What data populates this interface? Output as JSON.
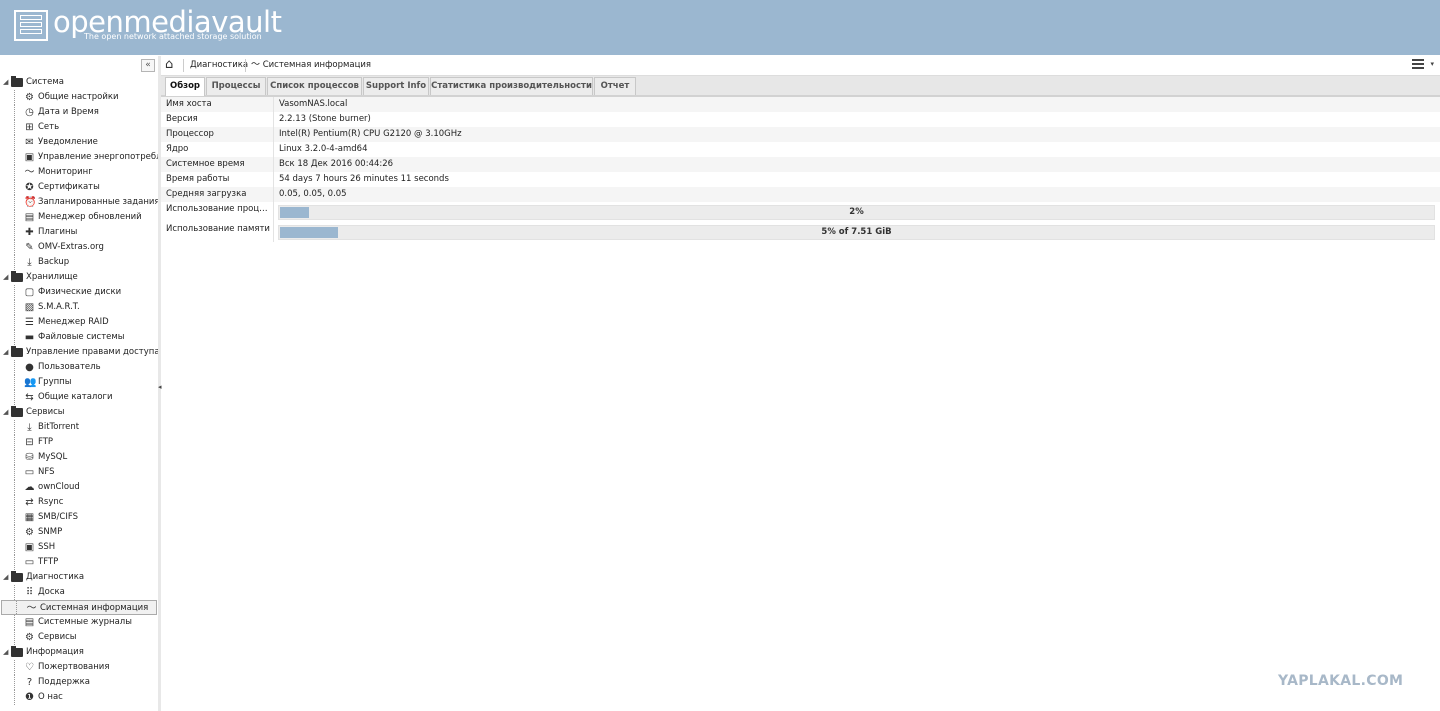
{
  "app": {
    "title": "openmediavault",
    "subtitle": "The open network attached storage solution"
  },
  "sidebar": {
    "collapse_label": "«",
    "sections": [
      {
        "label": "Система",
        "items": [
          {
            "label": "Общие настройки",
            "icon": "⚙"
          },
          {
            "label": "Дата и Время",
            "icon": "◷"
          },
          {
            "label": "Сеть",
            "icon": "⊞"
          },
          {
            "label": "Уведомление",
            "icon": "✉"
          },
          {
            "label": "Управление энергопотреблением",
            "icon": "▣"
          },
          {
            "label": "Мониторинг",
            "icon": "〜"
          },
          {
            "label": "Сертификаты",
            "icon": "✪"
          },
          {
            "label": "Запланированные задания",
            "icon": "⏰"
          },
          {
            "label": "Менеджер обновлений",
            "icon": "▤"
          },
          {
            "label": "Плагины",
            "icon": "✚"
          },
          {
            "label": "OMV-Extras.org",
            "icon": "✎"
          },
          {
            "label": "Backup",
            "icon": "⤓"
          }
        ]
      },
      {
        "label": "Хранилище",
        "items": [
          {
            "label": "Физические диски",
            "icon": "▢"
          },
          {
            "label": "S.M.A.R.T.",
            "icon": "▨"
          },
          {
            "label": "Менеджер RAID",
            "icon": "☰"
          },
          {
            "label": "Файловые системы",
            "icon": "▬"
          }
        ]
      },
      {
        "label": "Управление правами доступа",
        "items": [
          {
            "label": "Пользователь",
            "icon": "●"
          },
          {
            "label": "Группы",
            "icon": "👥"
          },
          {
            "label": "Общие каталоги",
            "icon": "⇆"
          }
        ]
      },
      {
        "label": "Сервисы",
        "items": [
          {
            "label": "BitTorrent",
            "icon": "⤓"
          },
          {
            "label": "FTP",
            "icon": "⊟"
          },
          {
            "label": "MySQL",
            "icon": "⛁"
          },
          {
            "label": "NFS",
            "icon": "▭"
          },
          {
            "label": "ownCloud",
            "icon": "☁"
          },
          {
            "label": "Rsync",
            "icon": "⇄"
          },
          {
            "label": "SMB/CIFS",
            "icon": "▦"
          },
          {
            "label": "SNMP",
            "icon": "⚙"
          },
          {
            "label": "SSH",
            "icon": "▣"
          },
          {
            "label": "TFTP",
            "icon": "▭"
          }
        ]
      },
      {
        "label": "Диагностика",
        "items": [
          {
            "label": "Доска",
            "icon": "⠿"
          },
          {
            "label": "Системная информация",
            "icon": "〜",
            "selected": true
          },
          {
            "label": "Системные журналы",
            "icon": "▤"
          },
          {
            "label": "Сервисы",
            "icon": "⚙"
          }
        ]
      },
      {
        "label": "Информация",
        "items": [
          {
            "label": "Пожертвования",
            "icon": "♡"
          },
          {
            "label": "Поддержка",
            "icon": "?"
          },
          {
            "label": "О нас",
            "icon": "❶"
          }
        ]
      }
    ]
  },
  "breadcrumb": {
    "home_icon": "home-icon",
    "items": [
      "Диагностика",
      "Системная информация"
    ]
  },
  "tabs": [
    "Обзор",
    "Процессы",
    "Список процессов",
    "Support Info",
    "Статистика производительности",
    "Отчет"
  ],
  "overview": {
    "rows": [
      {
        "key": "Имя хоста",
        "value": "VasomNAS.local"
      },
      {
        "key": "Версия",
        "value": "2.2.13 (Stone burner)"
      },
      {
        "key": "Процессор",
        "value": "Intel(R) Pentium(R) CPU G2120 @ 3.10GHz"
      },
      {
        "key": "Ядро",
        "value": "Linux 3.2.0-4-amd64"
      },
      {
        "key": "Системное время",
        "value": "Вск 18 Дек 2016 00:44:26"
      },
      {
        "key": "Время работы",
        "value": "54 days 7 hours 26 minutes 11 seconds"
      },
      {
        "key": "Средняя загрузка",
        "value": "0.05, 0.05, 0.05"
      }
    ],
    "cpu": {
      "key": "Использование процессора",
      "text": "2%",
      "fraction": 0.025
    },
    "memory": {
      "key": "Использование памяти",
      "text": "5% of 7.51 GiB",
      "fraction": 0.05
    }
  },
  "watermark": "YAPLAKAL.COM"
}
